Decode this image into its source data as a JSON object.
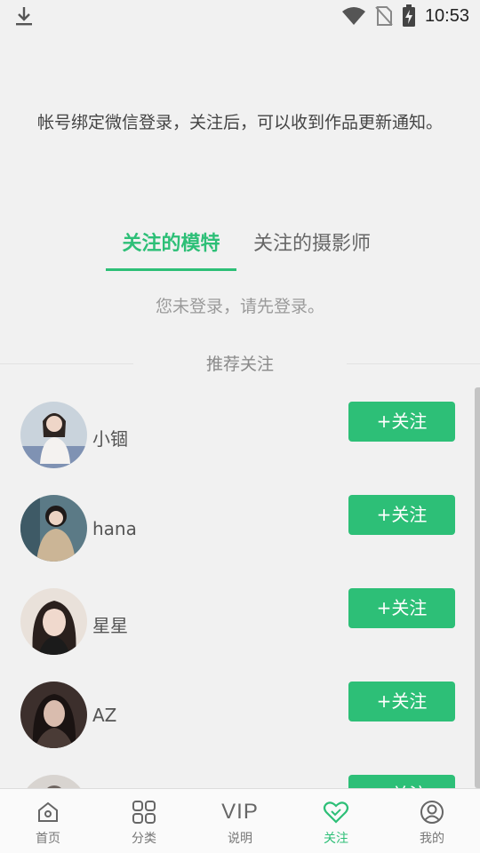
{
  "status_bar": {
    "time": "10:53",
    "icons": [
      "download-icon",
      "wifi-icon",
      "no-sim-icon",
      "battery-charging-icon"
    ]
  },
  "notice": "帐号绑定微信登录，关注后，可以收到作品更新通知。",
  "tabs": [
    {
      "label": "关注的模特",
      "active": true
    },
    {
      "label": "关注的摄影师",
      "active": false
    }
  ],
  "login_message": "您未登录，请先登录。",
  "recommend_title": "推荐关注",
  "recommendations": [
    {
      "name": "小锢",
      "button": "+关注"
    },
    {
      "name": "hana",
      "button": "+关注"
    },
    {
      "name": "星星",
      "button": "+关注"
    },
    {
      "name": "AZ",
      "button": "+关注"
    },
    {
      "name": "",
      "button": "+关注"
    }
  ],
  "bottom_nav": [
    {
      "label": "首页",
      "icon": "home-icon",
      "active": false
    },
    {
      "label": "分类",
      "icon": "grid-icon",
      "active": false
    },
    {
      "label": "说明",
      "icon": "VIP",
      "active": false
    },
    {
      "label": "关注",
      "icon": "heart-icon",
      "active": true
    },
    {
      "label": "我的",
      "icon": "user-icon",
      "active": false
    }
  ],
  "colors": {
    "accent": "#2dbf77",
    "background": "#f1f1f1"
  }
}
